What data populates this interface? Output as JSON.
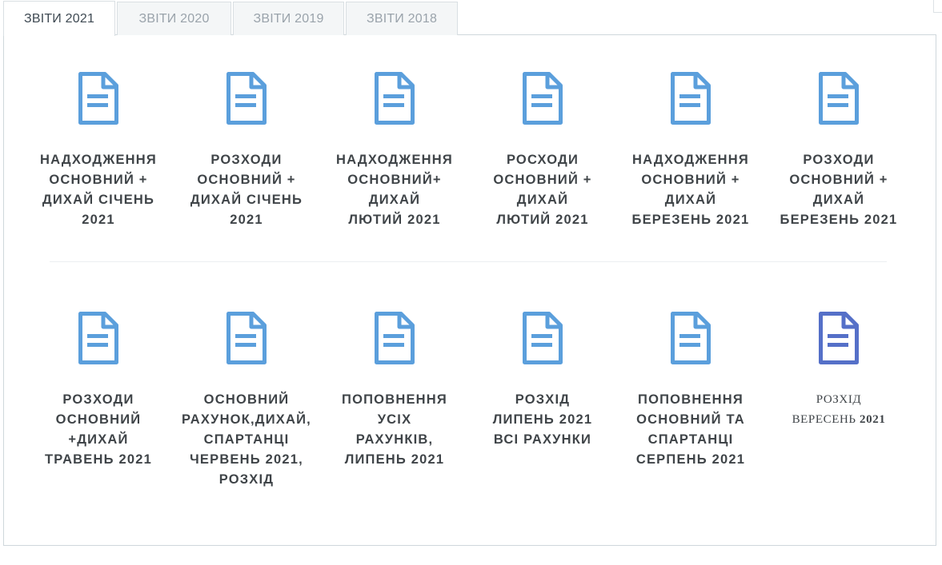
{
  "tabs": [
    {
      "label": "ЗВІТИ 2021",
      "active": true
    },
    {
      "label": "ЗВІТИ 2020",
      "active": false
    },
    {
      "label": "ЗВІТИ 2019",
      "active": false
    },
    {
      "label": "ЗВІТИ 2018",
      "active": false
    }
  ],
  "colors": {
    "icon_blue": "#5b9fdc",
    "icon_indigo": "#5570c8",
    "text": "#3f4448"
  },
  "rows": [
    {
      "items": [
        {
          "icon": "document-icon",
          "label": "НАДХОДЖЕННЯ\nОСНОВНИЙ +\nДИХАЙ СІЧЕНЬ\n2021"
        },
        {
          "icon": "document-icon",
          "label": "РОЗХОДИ\nОСНОВНИЙ +\nДИХАЙ СІЧЕНЬ\n2021"
        },
        {
          "icon": "document-icon",
          "label": "НАДХОДЖЕННЯ\nОСНОВНИЙ+\nДИХАЙ\nЛЮТИЙ 2021"
        },
        {
          "icon": "document-icon",
          "label": "РОСХОДИ\nОСНОВНИЙ +\nДИХАЙ\nЛЮТИЙ 2021"
        },
        {
          "icon": "document-icon",
          "label": "НАДХОДЖЕННЯ\nОСНОВНИЙ +\nДИХАЙ\nБЕРЕЗЕНЬ 2021"
        },
        {
          "icon": "document-icon",
          "label": "РОЗХОДИ\nОСНОВНИЙ +\nДИХАЙ\nБЕРЕЗЕНЬ 2021"
        }
      ]
    },
    {
      "items": [
        {
          "icon": "document-icon",
          "label": "РОЗХОДИ\nОСНОВНИЙ\n+ДИХАЙ\nТРАВЕНЬ 2021"
        },
        {
          "icon": "document-icon",
          "label": "ОСНОВНИЙ\nРАХУНОК,ДИХАЙ,\nСПАРТАНЦІ\nЧЕРВЕНЬ 2021,\nРОЗХІД"
        },
        {
          "icon": "document-icon",
          "label": "ПОПОВНЕННЯ\nУСІХ\nРАХУНКІВ,\nЛИПЕНЬ 2021"
        },
        {
          "icon": "document-icon",
          "label": "РОЗХІД\nЛИПЕНЬ 2021\nВСІ РАХУНКИ"
        },
        {
          "icon": "document-icon",
          "label": "ПОПОВНЕННЯ\nОСНОВНИЙ ТА\nСПАРТАНЦІ\nСЕРПЕНЬ 2021"
        },
        {
          "icon": "document-icon",
          "label_line1": "РОЗХІД",
          "label_line2_text": "ВЕРЕСЕНЬ",
          "label_line2_year": "2021",
          "serif": true
        }
      ]
    }
  ]
}
